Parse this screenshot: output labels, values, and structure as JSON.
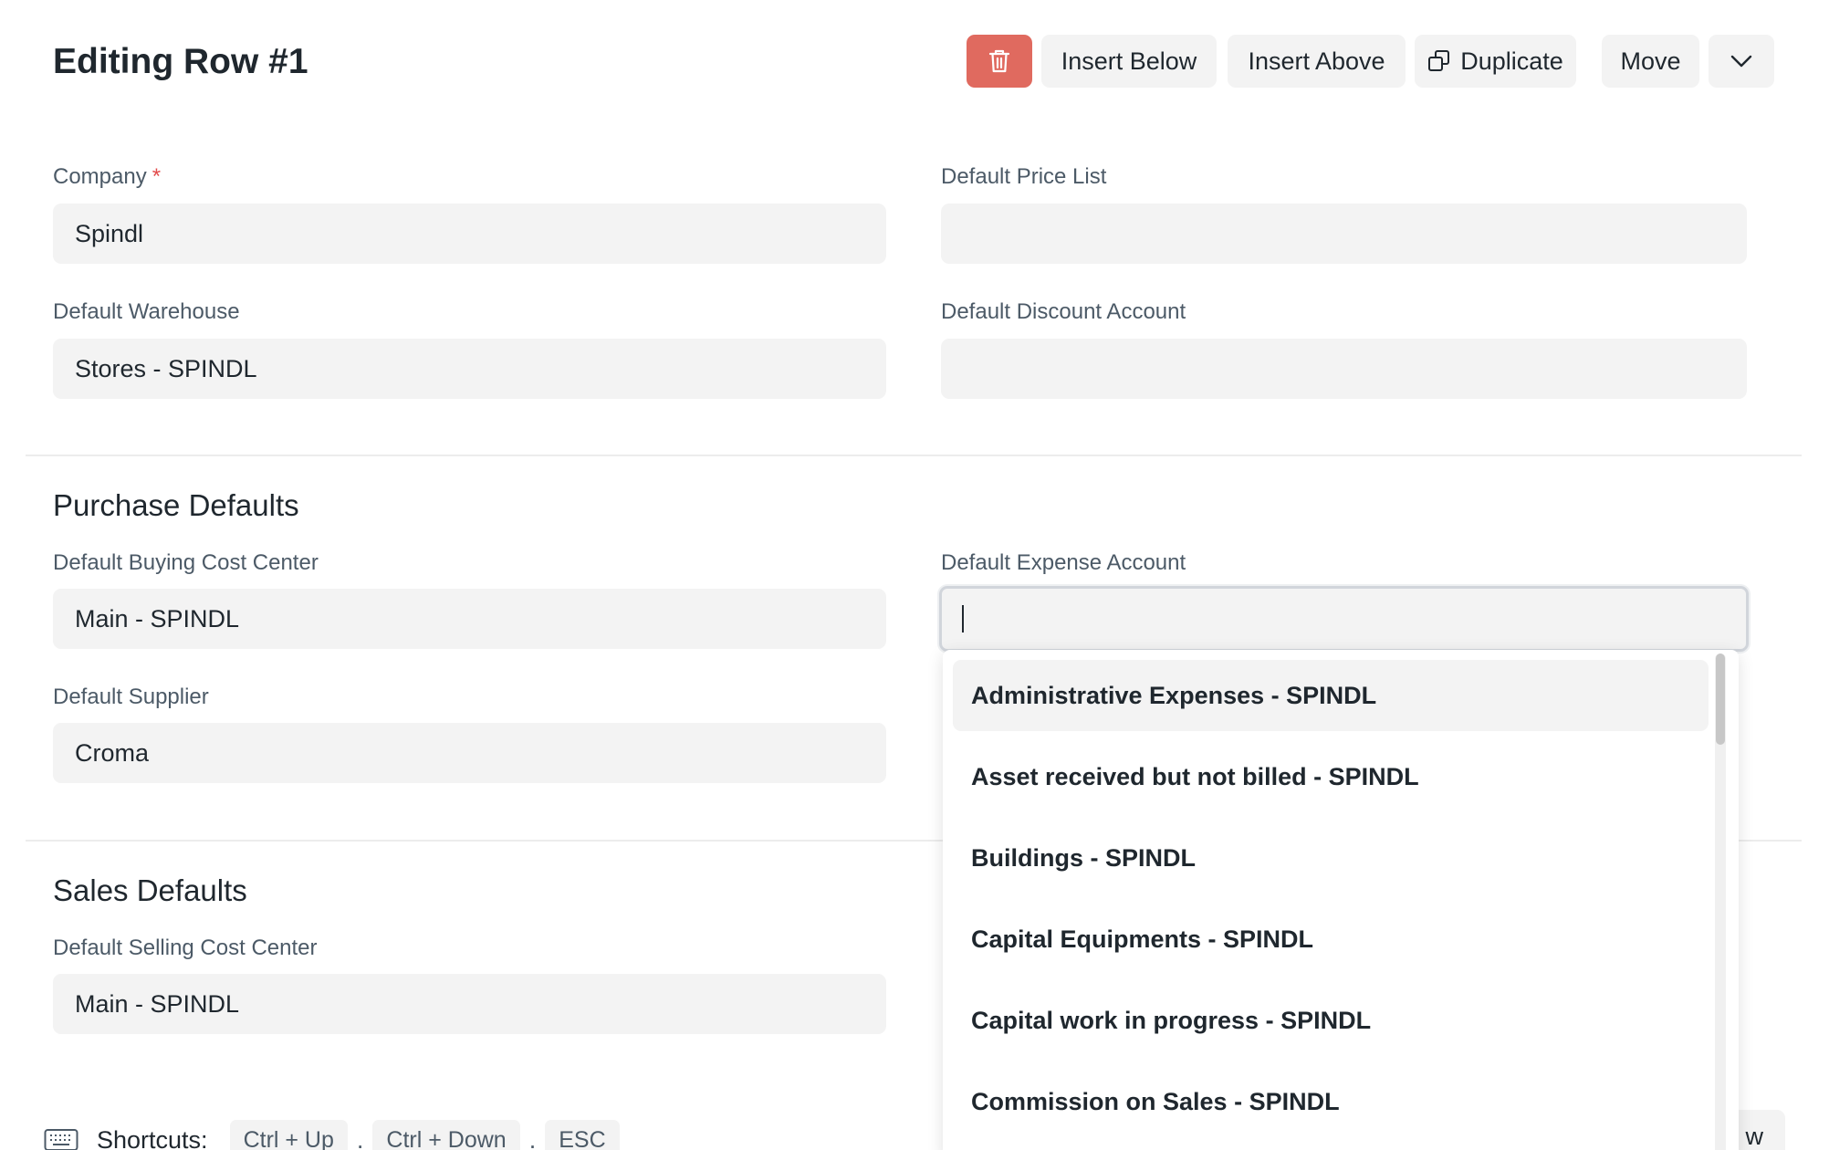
{
  "header": {
    "title": "Editing Row #1",
    "toolbar": {
      "delete_icon": "trash-icon",
      "insert_below": "Insert Below",
      "insert_above": "Insert Above",
      "duplicate": "Duplicate",
      "duplicate_icon": "duplicate-icon",
      "move": "Move",
      "more_icon": "chevron-down-icon"
    }
  },
  "colors": {
    "delete_button": "#e06a5f",
    "required_marker": "#e24c4c",
    "field_background": "#f3f3f3"
  },
  "fields": {
    "company": {
      "label": "Company",
      "required": "*",
      "value": "Spindl"
    },
    "default_price_list": {
      "label": "Default Price List",
      "value": ""
    },
    "default_warehouse": {
      "label": "Default Warehouse",
      "value": "Stores - SPINDL"
    },
    "default_discount_account": {
      "label": "Default Discount Account",
      "value": ""
    }
  },
  "purchase_defaults": {
    "title": "Purchase Defaults",
    "buying_cost_center": {
      "label": "Default Buying Cost Center",
      "value": "Main - SPINDL"
    },
    "expense_account": {
      "label": "Default Expense Account",
      "value": ""
    },
    "supplier": {
      "label": "Default Supplier",
      "value": "Croma"
    }
  },
  "sales_defaults": {
    "title": "Sales Defaults",
    "selling_cost_center": {
      "label": "Default Selling Cost Center",
      "value": "Main - SPINDL"
    }
  },
  "dropdown": {
    "items": [
      "Administrative Expenses - SPINDL",
      "Asset received but not billed - SPINDL",
      "Buildings - SPINDL",
      "Capital Equipments - SPINDL",
      "Capital work in progress - SPINDL",
      "Commission on Sales - SPINDL"
    ],
    "active_index": 0
  },
  "footer": {
    "shortcuts_label": "Shortcuts:",
    "keys": [
      "Ctrl + Up",
      "Ctrl + Down",
      "ESC"
    ],
    "separator": ".",
    "partial_button": "w",
    "keyboard_icon": "keyboard-icon"
  }
}
